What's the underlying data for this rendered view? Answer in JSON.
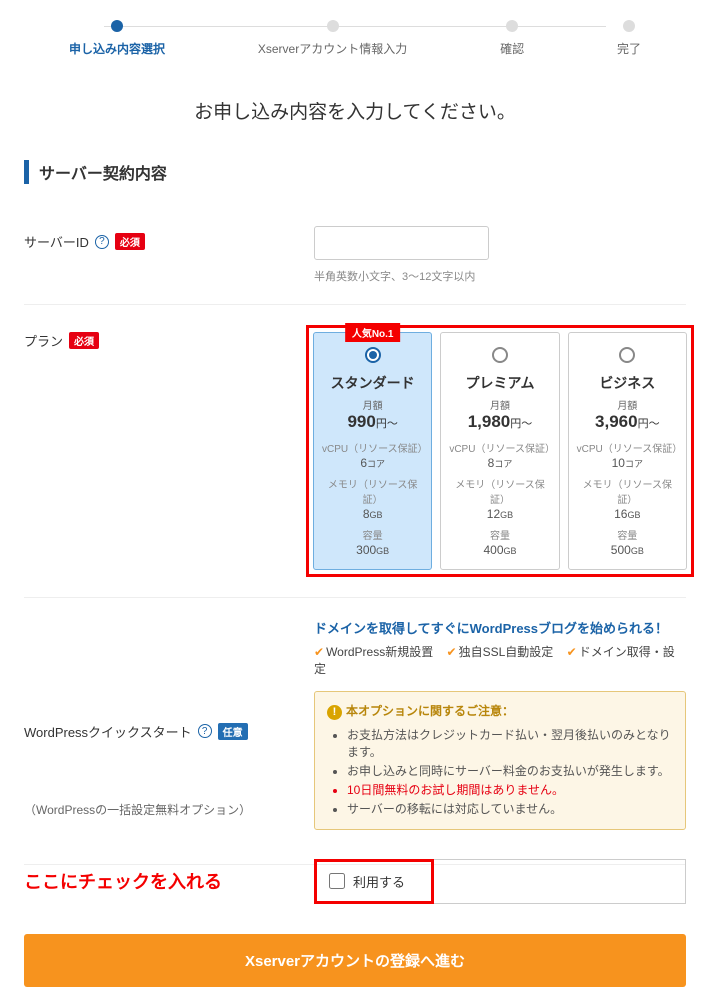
{
  "stepper": {
    "steps": [
      {
        "label": "申し込み内容選択"
      },
      {
        "label": "Xserverアカウント情報入力"
      },
      {
        "label": "確認"
      },
      {
        "label": "完了"
      }
    ]
  },
  "page_title": "お申し込み内容を入力してください。",
  "section_title": "サーバー契約内容",
  "badges": {
    "required": "必須",
    "optional": "任意"
  },
  "server_id": {
    "label": "サーバーID",
    "hint": "半角英数小文字、3～12文字以内",
    "value": ""
  },
  "plan": {
    "label": "プラン",
    "spec_labels": {
      "vcpu": "vCPU（リソース保証）",
      "mem": "メモリ（リソース保証）",
      "cap": "容量"
    },
    "cards": [
      {
        "badge": "人気No.1",
        "name": "スタンダード",
        "monthly_label": "月額",
        "price": "990",
        "yen": "円～",
        "vcpu": "6",
        "core": "コア",
        "mem": "8",
        "gb": "GB",
        "cap": "300"
      },
      {
        "name": "プレミアム",
        "monthly_label": "月額",
        "price": "1,980",
        "yen": "円～",
        "vcpu": "8",
        "core": "コア",
        "mem": "12",
        "gb": "GB",
        "cap": "400"
      },
      {
        "name": "ビジネス",
        "monthly_label": "月額",
        "price": "3,960",
        "yen": "円～",
        "vcpu": "10",
        "core": "コア",
        "mem": "16",
        "gb": "GB",
        "cap": "500"
      }
    ]
  },
  "wp": {
    "label": "WordPressクイックスタート",
    "sublabel": "（WordPressの一括設定無料オプション）",
    "lead": "ドメインを取得してすぐにWordPressブログを始められる！",
    "features": [
      "WordPress新規設置",
      "独自SSL自動設定",
      "ドメイン取得・設定"
    ],
    "notice_head": "本オプションに関するご注意：",
    "notice_items": [
      {
        "text": "お支払方法はクレジットカード払い・翌月後払いのみとなります。"
      },
      {
        "text": "お申し込みと同時にサーバー料金のお支払いが発生します。"
      },
      {
        "text": "10日間無料のお試し期間はありません。",
        "warn": true
      },
      {
        "text": "サーバーの移転には対応していません。"
      }
    ],
    "checkbox_label": "利用する"
  },
  "annotation": "ここにチェックを入れる",
  "submit_label": "Xserverアカウントの登録へ進む"
}
